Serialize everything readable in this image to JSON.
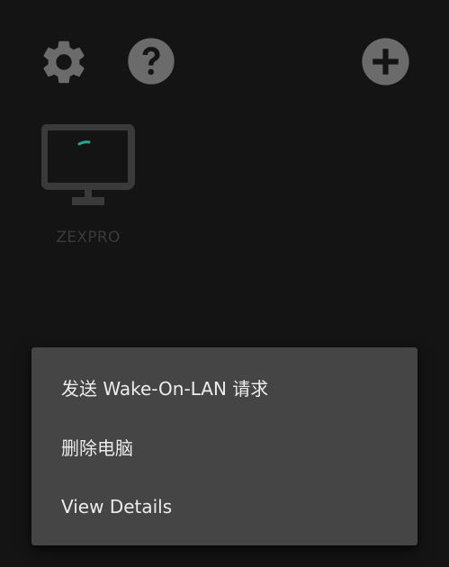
{
  "toolbar": {
    "settings_icon": "gear-icon",
    "help_icon": "question-circle-icon",
    "add_icon": "plus-circle-icon"
  },
  "pc": {
    "name": "ZEXPRO",
    "icon": "monitor-icon"
  },
  "context_menu": {
    "items": [
      {
        "label": "发送 Wake-On-LAN 请求"
      },
      {
        "label": "删除电脑"
      },
      {
        "label": "View Details"
      }
    ]
  },
  "colors": {
    "background": "#141414",
    "icon": "#6b6b6b",
    "menu_background": "#454545",
    "menu_text": "#ececec",
    "accent": "#2fa39a"
  }
}
